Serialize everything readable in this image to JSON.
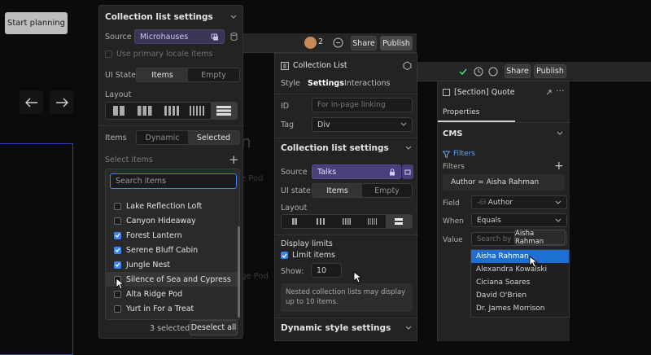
{
  "canvas": {
    "start_button": "Start planning",
    "partial_text_1": "n",
    "partial_text_2": "e Pod",
    "partial_text_3": "ge Pod"
  },
  "collection_list_settings_panel": {
    "title": "Collection list settings",
    "source_label": "Source",
    "source_value": "Microhauses",
    "primary_locale": "Use primary locale items",
    "ui_state_label": "UI State",
    "ui_state_options": [
      "Items",
      "Empty"
    ],
    "layout_label": "Layout",
    "items_label": "Items",
    "items_options": [
      "Dynamic",
      "Selected"
    ],
    "select_items_label": "Select items",
    "search_placeholder": "Search items",
    "items": [
      {
        "label": "Lake Reflection Loft",
        "checked": false
      },
      {
        "label": "Canyon Hideaway",
        "checked": false
      },
      {
        "label": "Forest Lantern",
        "checked": true
      },
      {
        "label": "Serene Bluff Cabin",
        "checked": true
      },
      {
        "label": "Jungle Nest",
        "checked": true
      },
      {
        "label": "Silence of Sea and Cypress",
        "checked": false
      },
      {
        "label": "Alta Ridge Pod",
        "checked": false
      },
      {
        "label": "Yurt in For a Treat",
        "checked": false
      }
    ],
    "selected_count": "3 selected",
    "deselect_all": "Deselect all"
  },
  "middle_panel": {
    "collaborator_count": "2",
    "share": "Share",
    "publish": "Publish",
    "element_title": "Collection List",
    "tabs": [
      "Style",
      "Settings",
      "Interactions"
    ],
    "id_label": "ID",
    "id_placeholder": "For in-page linking",
    "tag_label": "Tag",
    "tag_value": "Div",
    "section_title": "Collection list settings",
    "source_label": "Source",
    "source_value": "Talks",
    "ui_state_label": "UI state",
    "ui_state_options": [
      "Items",
      "Empty"
    ],
    "layout_label": "Layout",
    "display_limits_label": "Display limits",
    "limit_items": "Limit items",
    "show_label": "Show:",
    "show_value": "10",
    "note": "Nested collection lists may display up to 10 items.",
    "dynamic_style_title": "Dynamic style settings"
  },
  "right_panel": {
    "share": "Share",
    "publish": "Publish",
    "element_title": "[Section] Quote",
    "tab_properties": "Properties",
    "cms_label": "CMS",
    "filters_link": "Filters",
    "filters_label": "Filters",
    "filter_chip": "Author = Aisha Rahman",
    "field_label": "Field",
    "field_value": "Author",
    "when_label": "When",
    "when_value": "Equals",
    "value_label": "Value",
    "value_placeholder": "Search by ite",
    "tooltip": "Aisha Rahman",
    "options": [
      "Aisha Rahman",
      "Alexandra Kowalski",
      "Ciciana Soares",
      "David O'Brien",
      "Dr. James Morrison"
    ],
    "highlighted_index": 0
  },
  "colors": {
    "accent_blue": "#3b82f6",
    "source_purple": "#4a3f7a",
    "panel_bg": "#232323"
  }
}
